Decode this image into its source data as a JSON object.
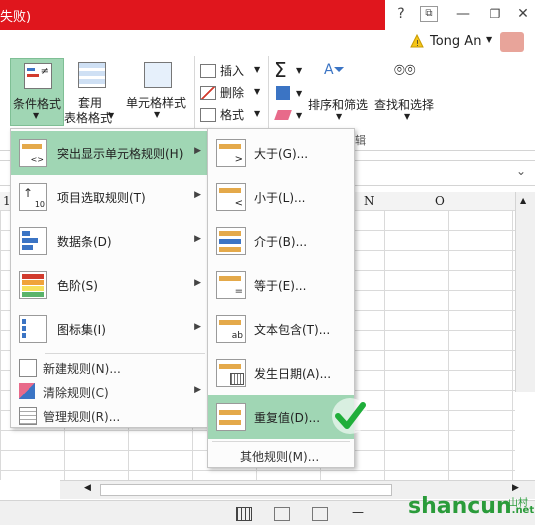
{
  "window": {
    "title_fragment": "失败)",
    "user": "Tong An",
    "help": "?",
    "restore": "⧉",
    "minimize": "—"
  },
  "ribbon": {
    "conditional_format": "条件格式",
    "table_format_1": "套用",
    "table_format_2": "表格格式",
    "cell_styles": "单元格样式",
    "insert": "插入",
    "delete": "删除",
    "format": "格式",
    "sort_filter": "排序和筛选",
    "find_select": "查找和选择",
    "group_edit": "编辑"
  },
  "columns": [
    "N",
    "O"
  ],
  "row_label": "1",
  "menu1": {
    "items": [
      {
        "label": "突出显示单元格规则(H)",
        "highlight": true
      },
      {
        "label": "项目选取规则(T)"
      },
      {
        "label": "数据条(D)"
      },
      {
        "label": "色阶(S)"
      },
      {
        "label": "图标集(I)"
      }
    ],
    "small": [
      {
        "label": "新建规则(N)..."
      },
      {
        "label": "清除规则(C)"
      },
      {
        "label": "管理规则(R)..."
      }
    ]
  },
  "menu2": {
    "items": [
      {
        "label": "大于(G)...",
        "icon": ">"
      },
      {
        "label": "小于(L)...",
        "icon": "<"
      },
      {
        "label": "介于(B)...",
        "icon": ""
      },
      {
        "label": "等于(E)...",
        "icon": "="
      },
      {
        "label": "文本包含(T)...",
        "icon": "ab"
      },
      {
        "label": "发生日期(A)...",
        "icon": "calendar"
      },
      {
        "label": "重复值(D)...",
        "icon": "",
        "highlight": true
      }
    ],
    "more": "其他规则(M)..."
  },
  "watermark": {
    "text": "shancun",
    "suffix": ".net",
    "cn": "山村"
  },
  "colors": {
    "accent_red": "#e0161d",
    "highlight": "#a0d6b4",
    "check_green": "#1fae3a"
  }
}
